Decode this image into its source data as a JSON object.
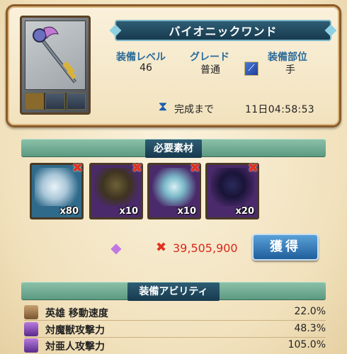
{
  "item": {
    "name": "バイオニックワンド",
    "equip_level_label": "装備レベル",
    "equip_level": "46",
    "grade_label": "グレード",
    "grade": "普通",
    "slot_label": "装備部位",
    "slot": "手",
    "timer_label": "完成まで",
    "timer_value": "11日04:58:53"
  },
  "materials": {
    "header": "必要素材",
    "items": [
      {
        "icon": "crystal-shard-icon",
        "qty": "x80",
        "color": "#2f6a8a"
      },
      {
        "icon": "claw-icon",
        "qty": "x10",
        "color": "#4a2a6a"
      },
      {
        "icon": "crystal-drop-icon",
        "qty": "x10",
        "color": "#4a2a6a"
      },
      {
        "icon": "dark-tentacle-icon",
        "qty": "x20",
        "color": "#4a2a6a"
      }
    ]
  },
  "cost": {
    "icon": "purple-gem-icon",
    "value": "39,505,900",
    "color": "#d8281a"
  },
  "acquire_button": "獲得",
  "abilities": {
    "header": "装備アビリティ",
    "items": [
      {
        "icon": "hero-helmet-icon",
        "name": "英雄 移動速度",
        "value": "22.0%"
      },
      {
        "icon": "beast-icon",
        "name": "対魔獣攻撃力",
        "value": "48.3%"
      },
      {
        "icon": "demihuman-icon",
        "name": "対亜人攻撃力",
        "value": "105.0%"
      }
    ]
  }
}
